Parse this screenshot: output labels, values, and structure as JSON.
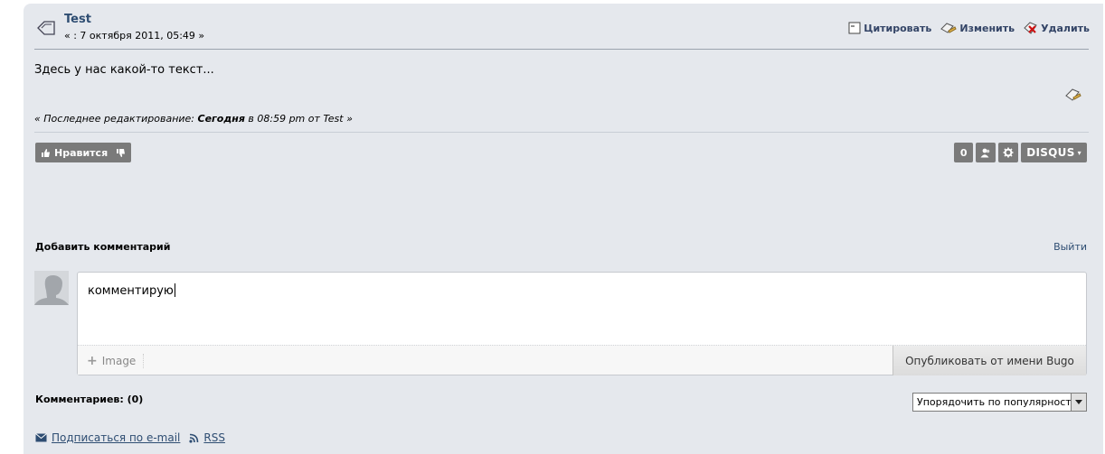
{
  "post": {
    "title": "Test",
    "date": "« : 7 октября 2011, 05:49 »",
    "actions": {
      "quote": "Цитировать",
      "edit": "Изменить",
      "delete": "Удалить"
    },
    "body": "Здесь у нас какой-то текст...",
    "edit_note": {
      "prefix": "« Последнее редактирование: ",
      "when": "Сегодня",
      "middle": " в 08:59 pm от Test »"
    }
  },
  "likes": {
    "like_label": "Нравится"
  },
  "disqus": {
    "count": "0",
    "logo": "DISQUS"
  },
  "comments": {
    "add_label": "Добавить комментарий",
    "logout": "Выйти",
    "input_value": "комментирую",
    "image_label": "Image",
    "publish_label": "Опубликовать от имени Bugo",
    "count_label": "Комментариев: (0)",
    "sort_selected": "Упорядочить по популярности"
  },
  "footer": {
    "subscribe": "Подписаться по e-mail",
    "rss": "RSS"
  },
  "colors": {
    "panel": "#e5e8ed",
    "link": "#2e4d72",
    "button": "#7a7a7a"
  }
}
